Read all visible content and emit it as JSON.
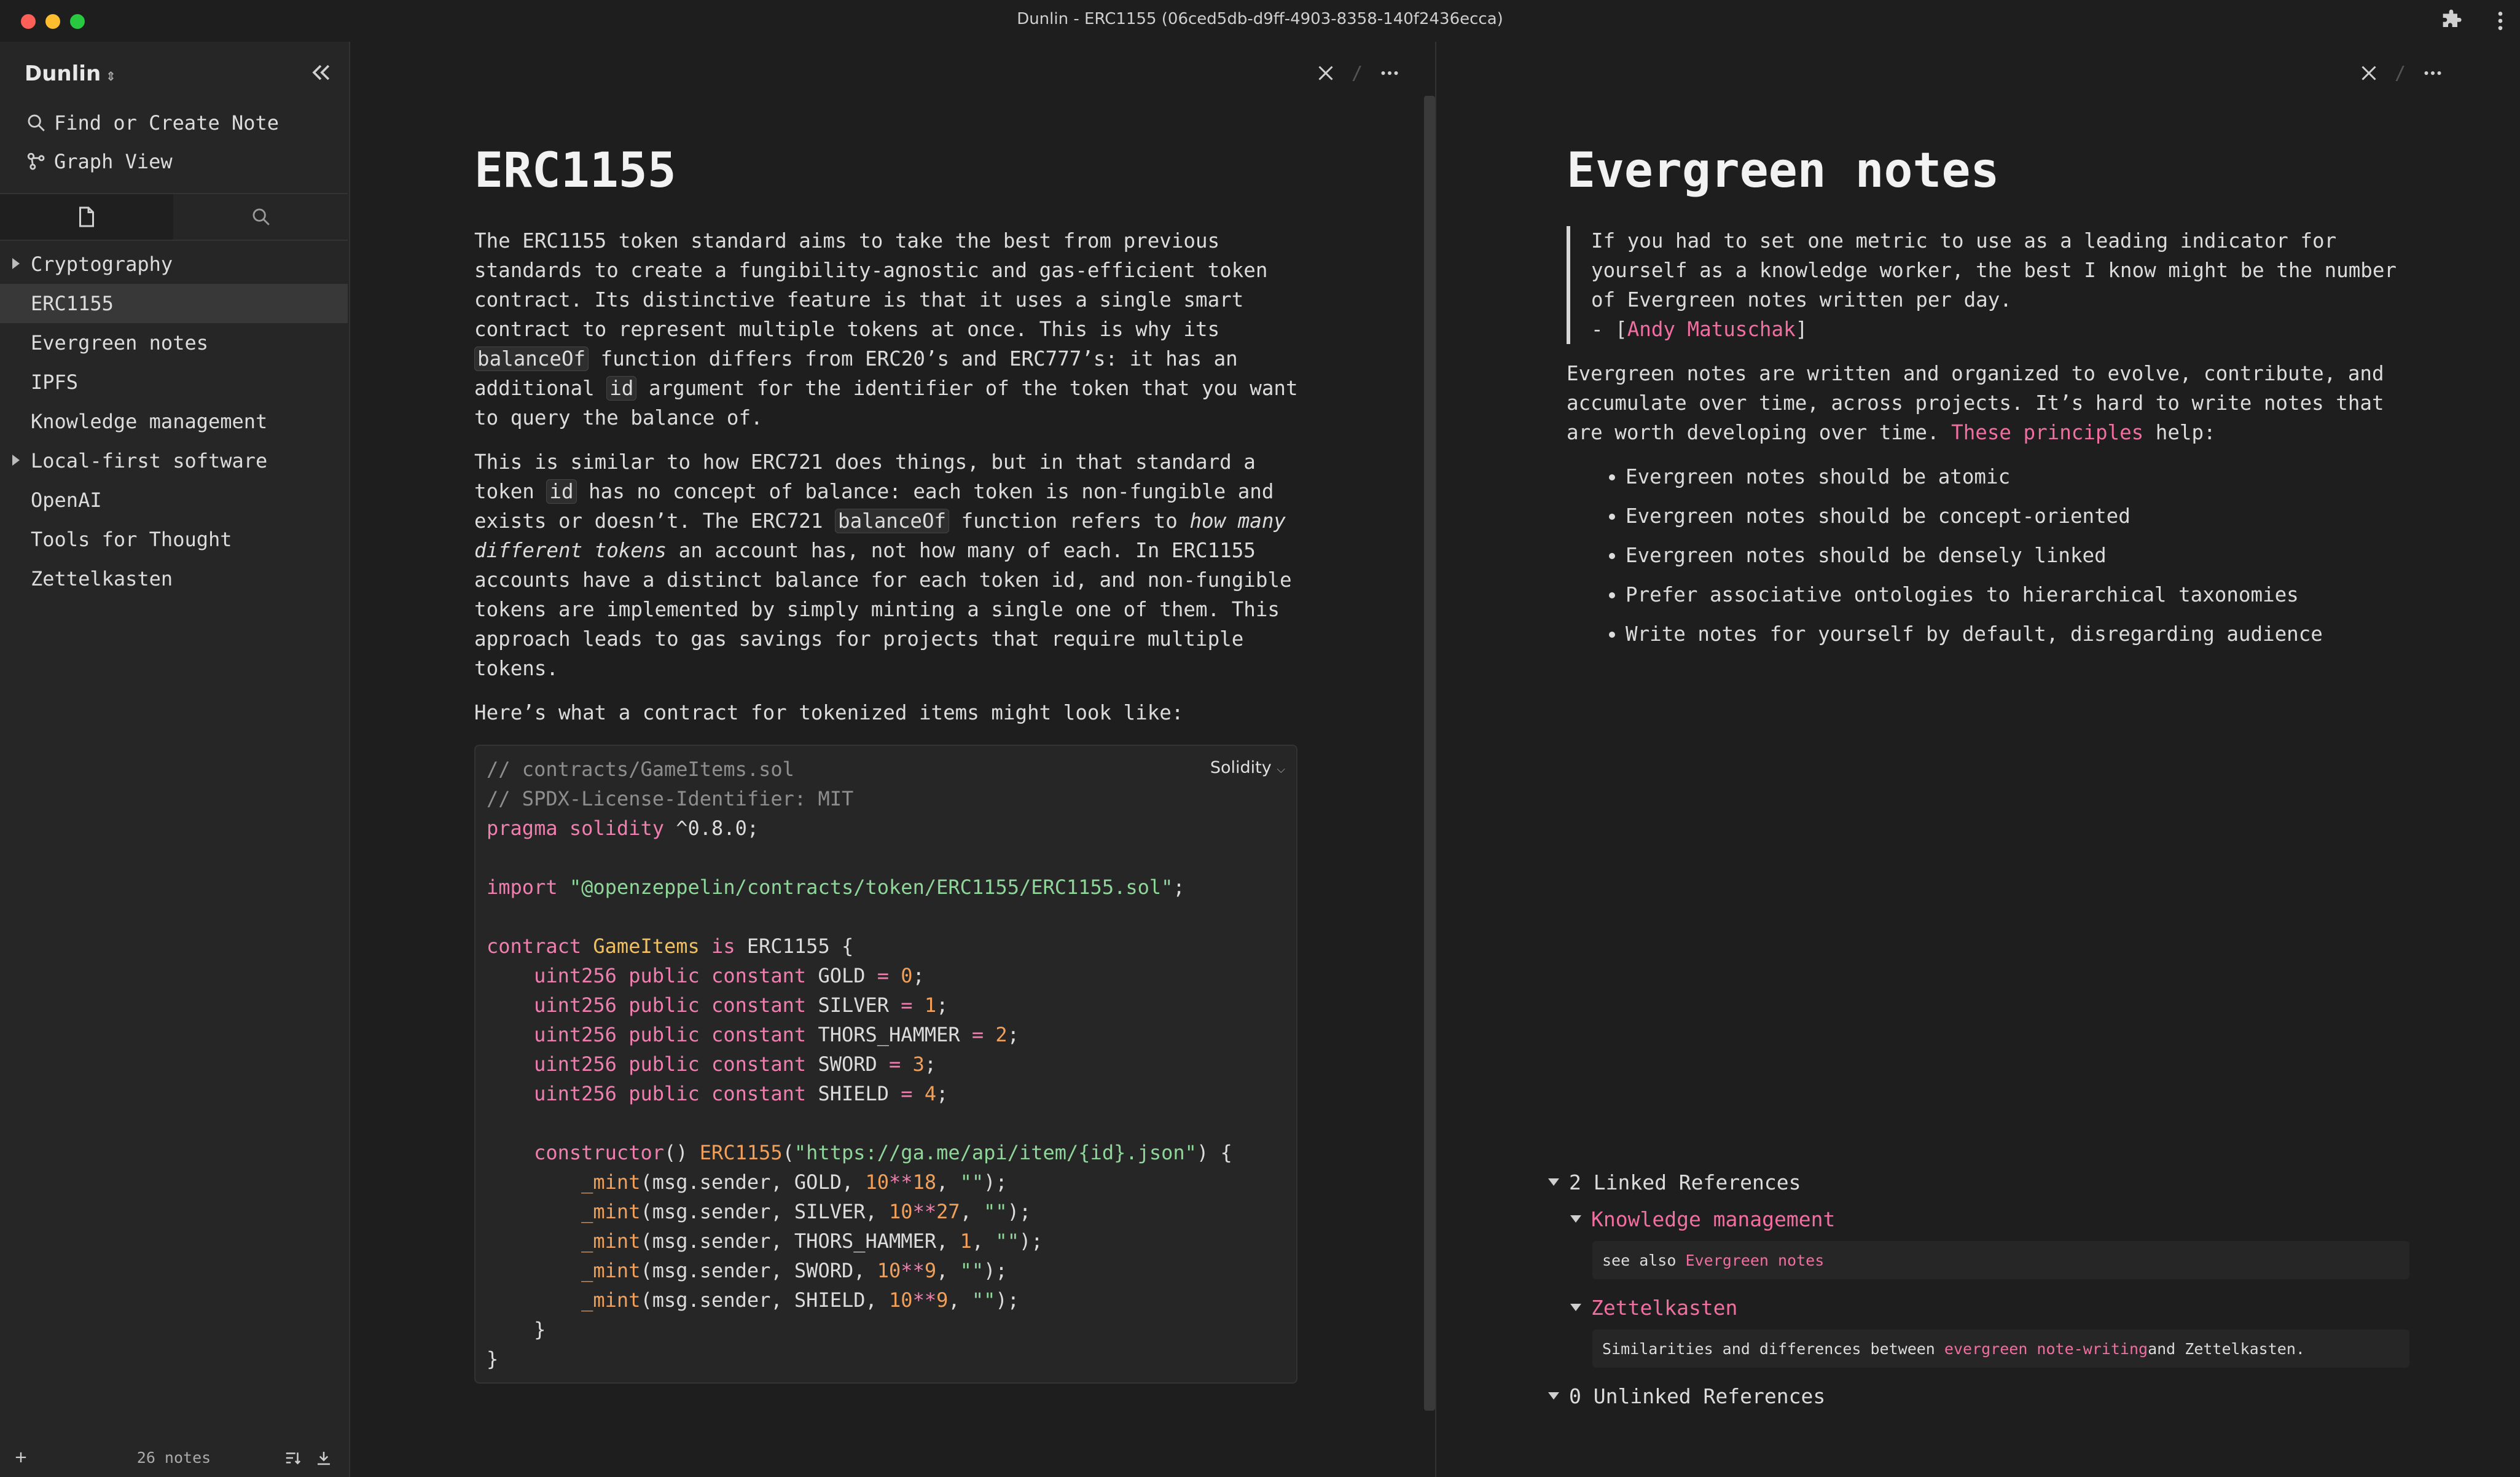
{
  "window": {
    "title": "Dunlin - ERC1155 (06ced5db-d9ff-4903-8358-140f2436ecca)"
  },
  "sidebar": {
    "vault_name": "Dunlin",
    "actions": [
      {
        "label": "Find or Create Note"
      },
      {
        "label": "Graph View"
      }
    ],
    "tree": [
      {
        "label": "Cryptography"
      },
      {
        "label": "ERC1155"
      },
      {
        "label": "Evergreen notes"
      },
      {
        "label": "IPFS"
      },
      {
        "label": "Knowledge management"
      },
      {
        "label": "Local-first software"
      },
      {
        "label": "OpenAI"
      },
      {
        "label": "Tools for Thought"
      },
      {
        "label": "Zettelkasten"
      }
    ],
    "footer": {
      "note_count": "26 notes"
    }
  },
  "left_note": {
    "title": "ERC1155",
    "p1": [
      "The ERC1155 token standard aims to take the best from previous",
      "standards to create a fungibility-agnostic and gas-efficient token",
      "contract. Its distinctive feature is that it uses a single smart",
      "contract to represent multiple tokens at once. This is why its",
      "balanceOf",
      " function differs from ERC20’s and ERC777’s: it has an",
      "additional ",
      "id",
      " argument for the identifier of the token that you want",
      "to query the balance of."
    ],
    "p2": [
      "This is similar to how ERC721 does things, but in that standard a",
      "token ",
      "id",
      " has no concept of balance: each token is non-fungible and",
      "exists or doesn’t. The ERC721 ",
      "balanceOf",
      " function refers to ",
      "how many",
      "different tokens",
      " an account has, not how many of each. In ERC1155",
      "accounts have a distinct balance for each token id, and non-fungible",
      "tokens are implemented by simply minting a single one of them. This",
      "approach leads to gas savings for projects that require multiple",
      "tokens."
    ],
    "p3": "Here’s what a contract for tokenized items might look like:",
    "code": {
      "language": "Solidity",
      "t": [
        "// contracts/GameItems.sol",
        "// SPDX-License-Identifier: MIT",
        "pragma solidity",
        " ^0.8.0;",
        "import",
        " ",
        "\"@openzeppelin/contracts/token/ERC1155/ERC1155.sol\"",
        ";",
        "contract",
        " ",
        "GameItems",
        " ",
        "is",
        " ERC1155 {",
        "uint256",
        "public",
        "constant",
        "GOLD",
        "=",
        "0",
        ";",
        "SILVER",
        "1",
        "THORS_HAMMER",
        "2",
        "SWORD",
        "3",
        "SHIELD",
        "4",
        "constructor",
        "()",
        "ERC1155",
        "(",
        "\"https://ga.me/api/item/{id}.json\"",
        ") {",
        "_mint",
        "(msg.sender, GOLD, ",
        "10",
        "**",
        "18",
        ", ",
        "\"\"",
        ");",
        "(msg.sender, SILVER, ",
        "27",
        "(msg.sender, THORS_HAMMER, ",
        "1",
        "(msg.sender, SWORD, ",
        "9",
        "(msg.sender, SHIELD, ",
        "}",
        "}"
      ]
    }
  },
  "right_note": {
    "title": "Evergreen notes",
    "quote": [
      "If you had to set one metric to use as a leading indicator for",
      "yourself as a knowledge worker, the best I know might be the number",
      "of Evergreen notes written per day.",
      "- [",
      "Andy Matuschak",
      "]"
    ],
    "para": [
      "Evergreen notes are written and organized to evolve, contribute, and",
      "accumulate over time, across projects. It’s hard to write notes that",
      "are worth developing over time. ",
      "These principles",
      " help:"
    ],
    "bullets": [
      "Evergreen notes should be atomic",
      "Evergreen notes should be concept-oriented",
      "Evergreen notes should be densely linked",
      "Prefer associative ontologies to hierarchical taxonomies",
      "Write notes for yourself by default, disregarding audience"
    ],
    "linked_refs": {
      "header": "2 Linked References",
      "items": [
        {
          "source": "Knowledge management",
          "ctx_pre": "see also ",
          "ctx_link": "Evergreen notes",
          "ctx_post": ""
        },
        {
          "source": "Zettelkasten",
          "ctx_pre": "Similarities and differences between ",
          "ctx_link": "evergreen note-writing",
          "ctx_post": " and Zettelkasten."
        }
      ]
    },
    "unlinked_refs": {
      "header": "0 Unlinked References"
    }
  },
  "icons": {
    "extensions": "puzzle-icon",
    "window_menu": "vertical-ellipsis-icon",
    "close": "close-icon",
    "more": "more-icon",
    "collapse": "double-chevron-left-icon"
  },
  "colors": {
    "background": "#1e1e1e",
    "sidebar": "#262626",
    "link": "#f06fa0",
    "code_keyword": "#f07fb0",
    "code_string": "#8fd69a",
    "code_number": "#f0a05a",
    "code_type": "#f0c060"
  }
}
